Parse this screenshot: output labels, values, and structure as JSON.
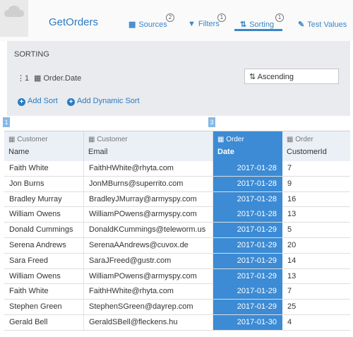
{
  "app": {
    "title": "GetOrders"
  },
  "tabs": [
    {
      "label": "Sources",
      "badge": "2",
      "icon": "grid-icon"
    },
    {
      "label": "Filters",
      "badge": "1",
      "icon": "filter-icon"
    },
    {
      "label": "Sorting",
      "badge": "1",
      "icon": "sort-icon",
      "active": true
    },
    {
      "label": "Test Values",
      "badge": "",
      "icon": "edit-icon"
    }
  ],
  "sorting": {
    "title": "SORTING",
    "row": {
      "index": "1",
      "field": "Order.Date",
      "direction": "Ascending"
    },
    "add_sort": "Add Sort",
    "add_dynamic_sort": "Add Dynamic Sort"
  },
  "markers": [
    "1",
    "3"
  ],
  "columns": [
    {
      "entity": "Customer",
      "attr": "Name"
    },
    {
      "entity": "Customer",
      "attr": "Email"
    },
    {
      "entity": "Order",
      "attr": "Date"
    },
    {
      "entity": "Order",
      "attr": "CustomerId"
    }
  ],
  "rows": [
    [
      "Faith White",
      "FaithHWhite@rhyta.com",
      "2017-01-28",
      "7"
    ],
    [
      "Jon Burns",
      "JonMBurns@superrito.com",
      "2017-01-28",
      "9"
    ],
    [
      "Bradley Murray",
      "BradleyJMurray@armyspy.com",
      "2017-01-28",
      "16"
    ],
    [
      "William Owens",
      "WilliamPOwens@armyspy.com",
      "2017-01-28",
      "13"
    ],
    [
      "Donald Cummings",
      "DonaldKCummings@teleworm.us",
      "2017-01-29",
      "5"
    ],
    [
      "Serena Andrews",
      "SerenaAAndrews@cuvox.de",
      "2017-01-29",
      "20"
    ],
    [
      "Sara Freed",
      "SaraJFreed@gustr.com",
      "2017-01-29",
      "14"
    ],
    [
      "William Owens",
      "WilliamPOwens@armyspy.com",
      "2017-01-29",
      "13"
    ],
    [
      "Faith White",
      "FaithHWhite@rhyta.com",
      "2017-01-29",
      "7"
    ],
    [
      "Stephen Green",
      "StephenSGreen@dayrep.com",
      "2017-01-29",
      "25"
    ],
    [
      "Gerald Bell",
      "GeraldSBell@fleckens.hu",
      "2017-01-30",
      "4"
    ]
  ],
  "colors": {
    "accent": "#3c8bd4",
    "link": "#2a7bc4",
    "panel": "#e9ebee",
    "header": "#eaf0f6"
  }
}
